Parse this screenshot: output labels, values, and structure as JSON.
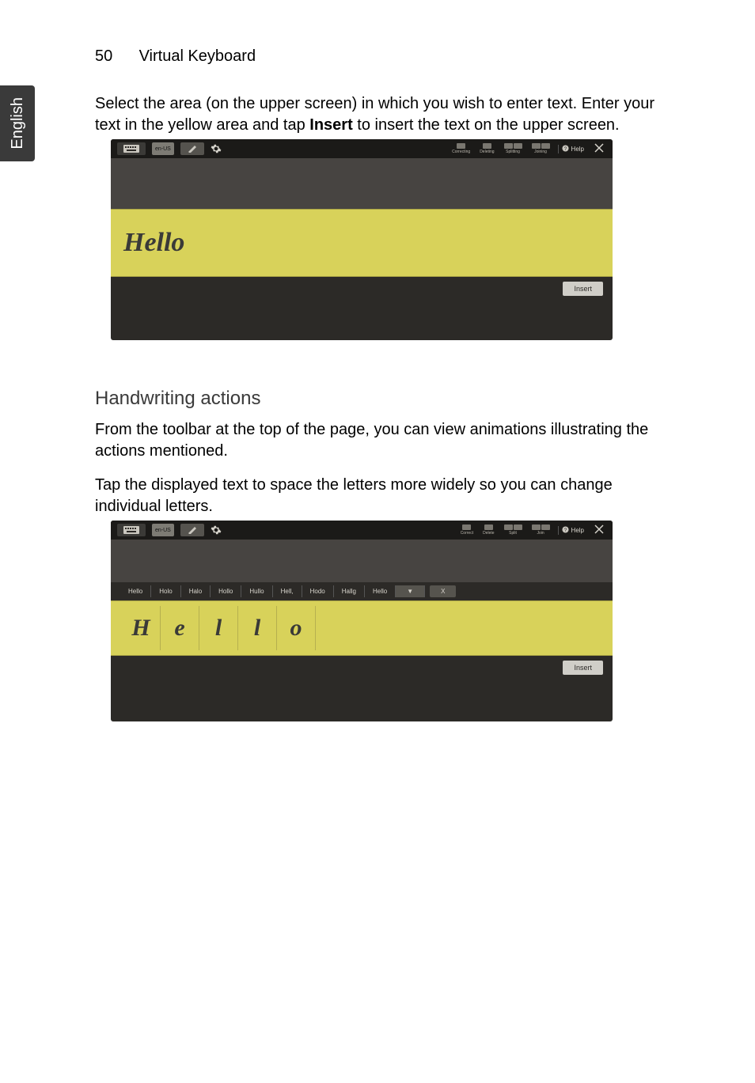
{
  "sideTab": "English",
  "header": {
    "pageNumber": "50",
    "title": "Virtual Keyboard"
  },
  "intro": {
    "line1": "Select the area (on the upper screen) in which you wish to enter text. Enter your text in the yellow area and tap ",
    "bold": "Insert",
    "line2": " to insert the text on the upper screen."
  },
  "shot1": {
    "lang": "en-US",
    "help": "Help",
    "groups": [
      "Correcting",
      "Deleting",
      "Splitting",
      "Joining"
    ],
    "word": "Hello",
    "insert": "Insert"
  },
  "section2Title": "Handwriting actions",
  "para2a": "From the toolbar at the top of the page, you can view animations illustrating the actions mentioned.",
  "para2b": "Tap the displayed text to space the letters more widely so you can change individual letters.",
  "shot2": {
    "lang": "en-US",
    "help": "Help",
    "groups": [
      "Correct",
      "Delete",
      "Split",
      "Join"
    ],
    "suggestions": [
      "Hello",
      "Holo",
      "Halo",
      "Hollo",
      "Hullo",
      "Hell,",
      "Hodo",
      "Hallg",
      "Hello"
    ],
    "dropdown": "▼",
    "clear": "X",
    "letters": [
      "H",
      "e",
      "l",
      "l",
      "o"
    ],
    "insert": "Insert"
  }
}
